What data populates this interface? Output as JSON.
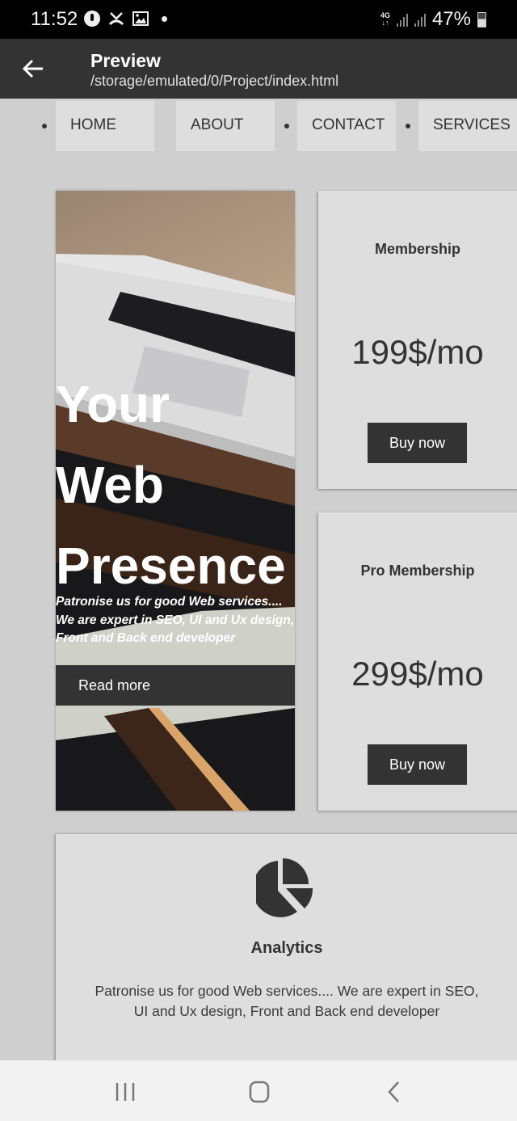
{
  "status_bar": {
    "time": "11:52",
    "left_icons": [
      "music-icon",
      "missed-call-icon",
      "gallery-icon",
      "dot-icon"
    ],
    "network": "4G",
    "battery": "47%"
  },
  "app_bar": {
    "title": "Preview",
    "path": "/storage/emulated/0/Project/index.html"
  },
  "nav": {
    "items": [
      {
        "label": "HOME"
      },
      {
        "label": "ABOUT"
      },
      {
        "label": "CONTACT"
      },
      {
        "label": "SERVICES"
      }
    ]
  },
  "hero": {
    "title_lines": [
      "Your",
      "Web",
      "Presence"
    ],
    "text": "Patronise us for good Web services.... We are expert in SEO, UI and Ux design, Front and Back end developer",
    "button": "Read more"
  },
  "pricing": [
    {
      "title": "Membership",
      "price": "199$/mo",
      "button": "Buy now"
    },
    {
      "title": "Pro Membership",
      "price": "299$/mo",
      "button": "Buy now"
    }
  ],
  "analytics": {
    "icon": "pie-chart-icon",
    "title": "Analytics",
    "text": "Patronise us for good Web services.... We are expert in SEO, UI and Ux design, Front and Back end developer"
  },
  "system_nav": {
    "buttons": [
      "recents-icon",
      "home-icon",
      "back-icon"
    ]
  },
  "colors": {
    "dark": "#333333",
    "card": "#dedede",
    "page": "#cfcfcf"
  }
}
